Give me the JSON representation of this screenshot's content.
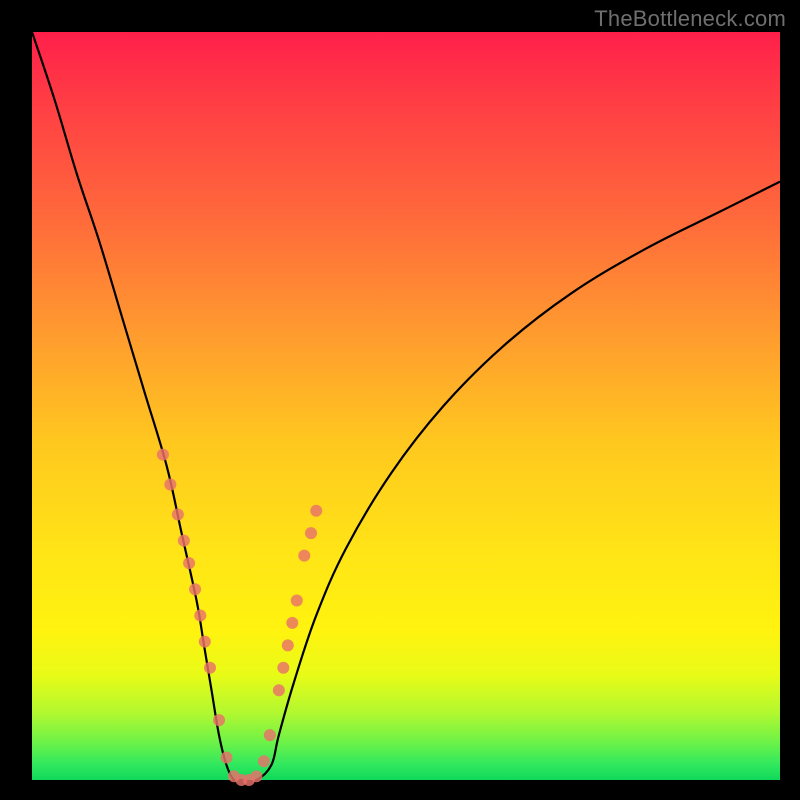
{
  "watermark": "TheBottleneck.com",
  "chart_data": {
    "type": "line",
    "title": "",
    "xlabel": "",
    "ylabel": "",
    "xlim": [
      0,
      100
    ],
    "ylim": [
      0,
      100
    ],
    "curve": {
      "name": "bottleneck-curve",
      "description": "V-shaped bottleneck curve; steep left arm, shallower right arm",
      "x": [
        0,
        3,
        6,
        9,
        12,
        15,
        18,
        20,
        22,
        23,
        24,
        25,
        26,
        27,
        28,
        30,
        32,
        33,
        35,
        38,
        42,
        48,
        55,
        63,
        72,
        82,
        92,
        100
      ],
      "y": [
        100,
        91,
        81,
        72,
        62,
        52,
        42,
        33,
        24,
        18,
        12,
        6,
        2,
        0,
        0,
        0,
        2,
        6,
        13,
        22,
        31,
        41,
        50,
        58,
        65,
        71,
        76,
        80
      ]
    },
    "markers": {
      "name": "curve-dots",
      "description": "Semi-transparent pink dots overlaid on lower portion of the V",
      "x": [
        17.5,
        18.5,
        19.5,
        20.3,
        21.0,
        21.8,
        22.5,
        23.1,
        23.8,
        25.0,
        26.0,
        27.0,
        28.0,
        29.0,
        30.0,
        31.0,
        31.8,
        33.0,
        33.6,
        34.2,
        34.8,
        35.4,
        36.4,
        37.3,
        38.0
      ],
      "y": [
        43.5,
        39.5,
        35.5,
        32.0,
        29.0,
        25.5,
        22.0,
        18.5,
        15.0,
        8.0,
        3.0,
        0.5,
        0.0,
        0.0,
        0.5,
        2.5,
        6.0,
        12.0,
        15.0,
        18.0,
        21.0,
        24.0,
        30.0,
        33.0,
        36.0
      ],
      "r": [
        6,
        6,
        6,
        6,
        6,
        6,
        6,
        6,
        6,
        6,
        6,
        6,
        6,
        6,
        6,
        6,
        6,
        6,
        6,
        6,
        6,
        6,
        6,
        6,
        6
      ]
    }
  }
}
